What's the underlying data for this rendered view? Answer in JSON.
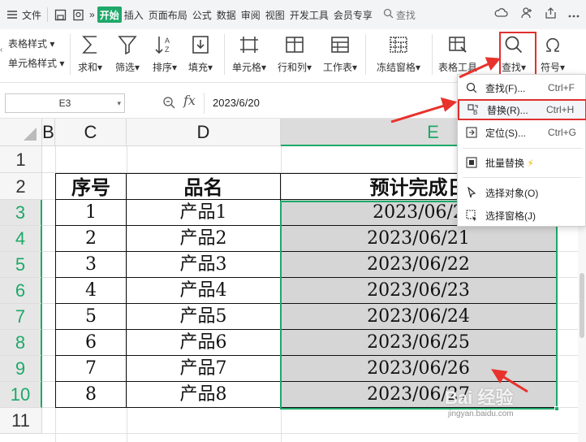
{
  "menubar": {
    "file": "文件",
    "tabs": [
      "开始",
      "插入",
      "页面布局",
      "公式",
      "数据",
      "审阅",
      "视图",
      "开发工具",
      "会员专享"
    ],
    "active_tab": "开始",
    "search": "查找",
    "more": "»"
  },
  "ribbon": {
    "left_items": [
      "表格样式",
      "单元格样式"
    ],
    "buttons": {
      "sum": "求和",
      "filter": "筛选",
      "sort": "排序",
      "fill": "填充",
      "cell": "单元格",
      "rowcol": "行和列",
      "sheet": "工作表",
      "freeze": "冻结窗格",
      "tabletools": "表格工具",
      "find": "查找",
      "symbol": "符号"
    }
  },
  "formula_bar": {
    "cell_ref": "E3",
    "fx": "fx",
    "value": "2023/6/20"
  },
  "sheet": {
    "columns": [
      "B",
      "C",
      "D",
      "E"
    ],
    "selected_column": "E",
    "row_numbers": [
      "1",
      "2",
      "3",
      "4",
      "5",
      "6",
      "7",
      "8",
      "9",
      "10",
      "11"
    ],
    "header": {
      "c": "序号",
      "d": "品名",
      "e": "预计完成日"
    },
    "rows": [
      {
        "c": "1",
        "d": "产品1",
        "e": "2023/06/2"
      },
      {
        "c": "2",
        "d": "产品2",
        "e": "2023/06/21"
      },
      {
        "c": "3",
        "d": "产品3",
        "e": "2023/06/22"
      },
      {
        "c": "4",
        "d": "产品4",
        "e": "2023/06/23"
      },
      {
        "c": "5",
        "d": "产品5",
        "e": "2023/06/24"
      },
      {
        "c": "6",
        "d": "产品6",
        "e": "2023/06/25"
      },
      {
        "c": "7",
        "d": "产品7",
        "e": "2023/06/26"
      },
      {
        "c": "8",
        "d": "产品8",
        "e": "2023/06/27"
      }
    ]
  },
  "find_menu": {
    "items": [
      {
        "label": "查找(F)...",
        "key": "Ctrl+F",
        "icon": "search-icon"
      },
      {
        "label": "替换(R)...",
        "key": "Ctrl+H",
        "icon": "replace-icon"
      },
      {
        "label": "定位(S)...",
        "key": "Ctrl+G",
        "icon": "goto-icon"
      },
      {
        "label": "批量替换",
        "key": "",
        "icon": "batch-replace-icon"
      },
      {
        "label": "选择对象(O)",
        "key": "",
        "icon": "select-object-icon"
      },
      {
        "label": "选择窗格(J)",
        "key": "",
        "icon": "selection-pane-icon"
      }
    ]
  },
  "watermark": {
    "brand": "Bai 经验",
    "url": "jingyan.baidu.com"
  },
  "colors": {
    "accent": "#1fa86a",
    "highlight": "#e03030",
    "selected_fill": "#d6d6d6"
  }
}
